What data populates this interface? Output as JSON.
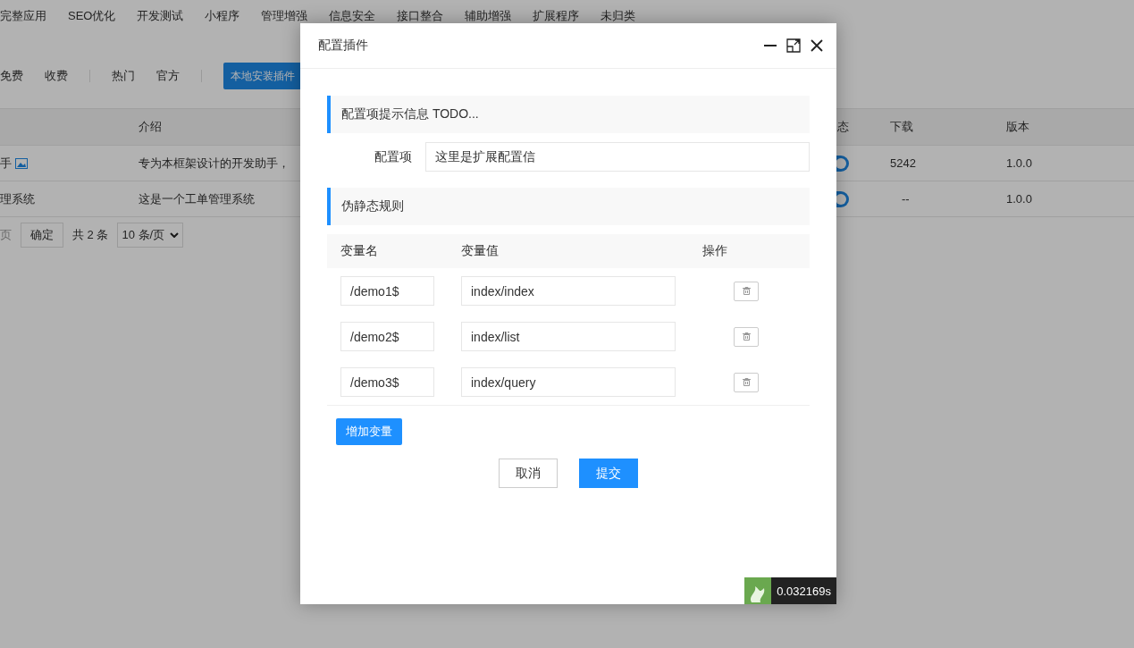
{
  "nav": [
    "完整应用",
    "SEO优化",
    "开发测试",
    "小程序",
    "管理增强",
    "信息安全",
    "接口整合",
    "辅助增强",
    "扩展程序",
    "未归类"
  ],
  "filter_groups": [
    [
      "免费",
      "收费"
    ],
    [
      "热门",
      "官方"
    ]
  ],
  "install_button": "本地安装插件",
  "table": {
    "columns": [
      "介绍",
      "态",
      "下载",
      "版本"
    ],
    "rows": [
      {
        "name": "手",
        "image_icon": true,
        "intro": "专为本框架设计的开发助手，",
        "enabled": true,
        "downloads": "5242",
        "version": "1.0.0"
      },
      {
        "name": "理系统",
        "image_icon": false,
        "intro": "这是一个工单管理系统",
        "enabled": true,
        "downloads": "--",
        "version": "1.0.0"
      }
    ]
  },
  "pagination": {
    "page_label": "页",
    "confirm": "确定",
    "total": "共 2 条",
    "page_size": "10 条/页"
  },
  "dialog": {
    "title": "配置插件",
    "config_section": {
      "title": "配置项提示信息 TODO...",
      "label": "配置项",
      "value": "这里是扩展配置信"
    },
    "rules_section": {
      "title": "伪静态规则",
      "columns": [
        "变量名",
        "变量值",
        "操作"
      ],
      "rows": [
        {
          "name": "/demo1$",
          "value": "index/index"
        },
        {
          "name": "/demo2$",
          "value": "index/list"
        },
        {
          "name": "/demo3$",
          "value": "index/query"
        }
      ],
      "add_button": "增加变量"
    },
    "cancel_button": "取消",
    "submit_button": "提交"
  },
  "timer": "0.032169s"
}
